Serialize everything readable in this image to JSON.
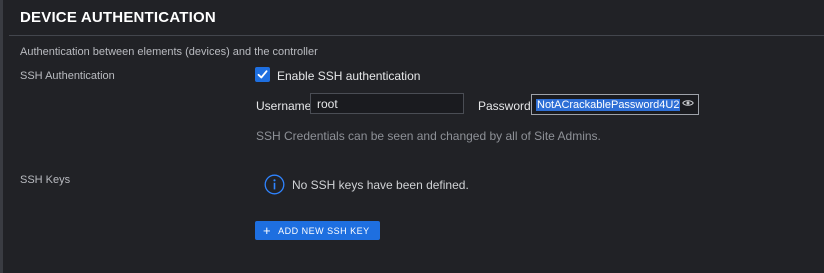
{
  "section": {
    "title": "DEVICE AUTHENTICATION",
    "subtitle": "Authentication between elements (devices) and the controller"
  },
  "ssh_auth": {
    "label": "SSH Authentication",
    "enable_checkbox": {
      "label": "Enable SSH authentication",
      "checked": true
    },
    "username": {
      "label": "Username",
      "value": "root"
    },
    "password": {
      "label": "Password",
      "value": "NotACrackablePassword4U2",
      "reveal_icon": "eye-icon"
    },
    "helper_text": "SSH Credentials can be seen and changed by all of Site Admins."
  },
  "ssh_keys": {
    "label": "SSH Keys",
    "empty_message": "No SSH keys have been defined.",
    "info_icon": "info-icon",
    "add_button": {
      "icon": "plus-icon",
      "label": "ADD NEW SSH KEY"
    }
  },
  "colors": {
    "background": "#212226",
    "accent": "#1e6fe0",
    "text_primary": "#e6e7e9",
    "text_muted": "#8e9197"
  }
}
